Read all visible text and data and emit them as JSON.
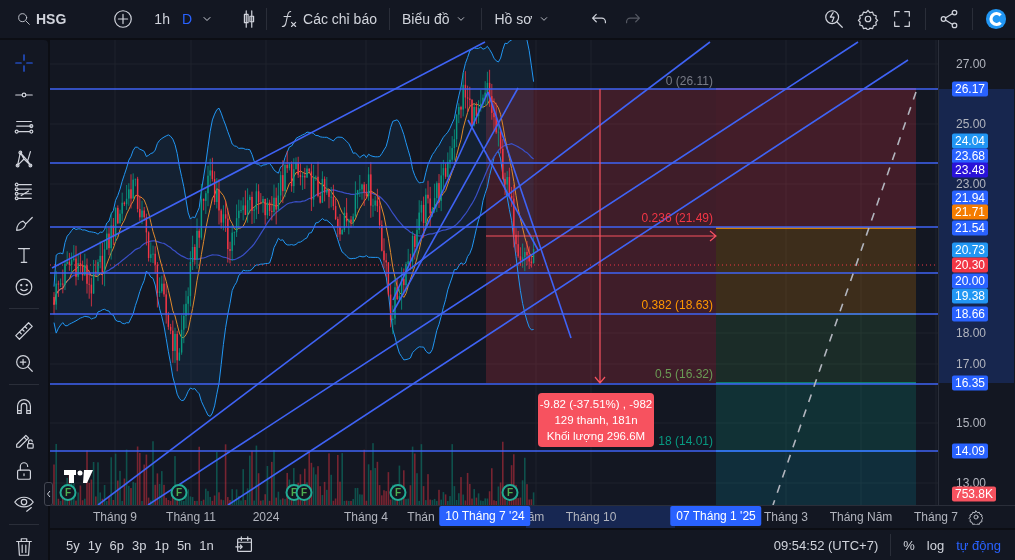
{
  "toolbar": {
    "symbol": "HSG",
    "intervals": [
      {
        "label": "1h",
        "selected": false
      },
      {
        "label": "D",
        "selected": true
      }
    ],
    "indicators_button": "Các chỉ báo",
    "chart_menu": "Biểu đồ",
    "profile_menu": "Hồ sơ",
    "redo_disabled": true
  },
  "drawing_tools": [
    {
      "selected": true
    },
    {
      "selected": false
    },
    {
      "selected": false
    },
    {
      "selected": false
    },
    {
      "selected": false
    },
    {
      "selected": false
    },
    {
      "selected": false
    },
    {
      "selected": false
    },
    {
      "selected": false
    },
    {
      "selected": false
    },
    {
      "selected": false
    },
    {
      "selected": false
    },
    {
      "selected": false
    },
    {
      "selected": false
    },
    {
      "selected": false
    }
  ],
  "chart": {
    "fib_levels": [
      {
        "label": "0 (26.11)",
        "color": "#787b86"
      },
      {
        "label": "0.236 (21.49)",
        "color": "#f23645"
      },
      {
        "label": "0.382 (18.63)",
        "color": "#ff9800"
      },
      {
        "label": "0.5 (16.32)",
        "color": "#6a9a55"
      },
      {
        "label": "18 (14.01)",
        "color": "#089981"
      }
    ],
    "measure_tooltip": [
      "-9.82 (-37.51%) , -982",
      "129 thanh, 181n",
      "Khối lượng 296.6M"
    ],
    "events": [
      {
        "label": "F"
      },
      {
        "label": "F"
      },
      {
        "label": "F"
      },
      {
        "label": "F"
      },
      {
        "label": "F"
      },
      {
        "label": "F"
      }
    ]
  },
  "price_axis": {
    "labels": [
      "27.00",
      "25.00",
      "23.00",
      "18.00",
      "17.00",
      "15.00",
      "13.00"
    ],
    "badges": [
      {
        "value": "26.17",
        "color": "#2962ff"
      },
      {
        "value": "24.04",
        "color": "#2196f3"
      },
      {
        "value": "23.68",
        "color": "#2962ff"
      },
      {
        "value": "23.48",
        "color": "#2a12d8"
      },
      {
        "value": "21.94",
        "color": "#2962ff"
      },
      {
        "value": "21.71",
        "color": "#f57c00"
      },
      {
        "value": "21.54",
        "color": "#2962ff"
      },
      {
        "value": "20.73",
        "color": "#2196f3"
      },
      {
        "value": "20.30",
        "color": "#f23645"
      },
      {
        "value": "20.00",
        "color": "#2962ff"
      },
      {
        "value": "19.38",
        "color": "#2196f3"
      },
      {
        "value": "18.66",
        "color": "#2962ff"
      },
      {
        "value": "16.35",
        "color": "#2962ff"
      },
      {
        "value": "14.09",
        "color": "#2962ff"
      },
      {
        "value": "753.8K",
        "color": "#f7525f"
      }
    ]
  },
  "time_axis": {
    "labels": [
      "Tháng 9",
      "Tháng 11",
      "2024",
      "Tháng 4",
      "Thán",
      "ăm",
      "Tháng 10",
      "Tháng 3",
      "Tháng Năm",
      "Tháng 7"
    ],
    "badges": [
      "10 Tháng 7 '24",
      "07 Tháng 1 '25"
    ]
  },
  "bottom_bar": {
    "ranges": [
      "5y",
      "1y",
      "6p",
      "3p",
      "1p",
      "5n",
      "1n"
    ],
    "time": "09:54:52 (UTC+7)",
    "scale_options": [
      {
        "label": "%",
        "selected": false
      },
      {
        "label": "log",
        "selected": false
      },
      {
        "label": "tự động",
        "selected": true
      }
    ]
  }
}
